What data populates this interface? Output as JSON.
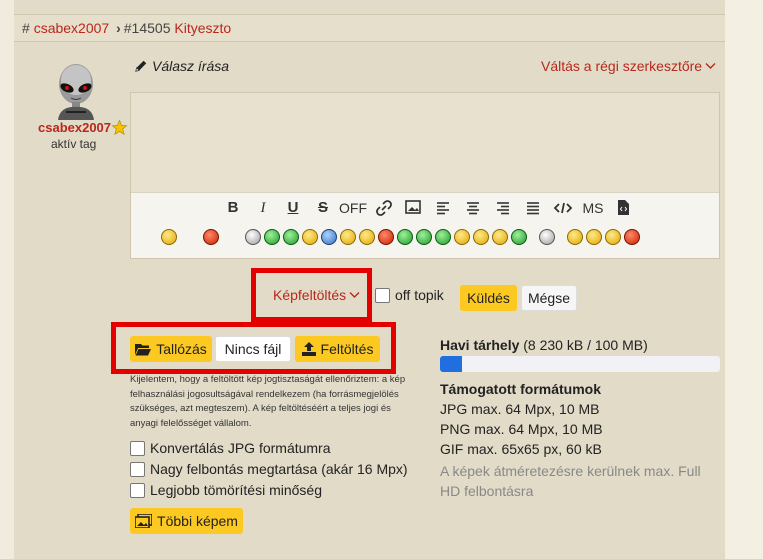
{
  "breadcrumb": {
    "hash": "#",
    "user": "csabex2007",
    "thread_id": "#14505",
    "thread_name": "Kityeszto"
  },
  "author": {
    "name": "csabex2007",
    "role": "aktív tag"
  },
  "editor": {
    "reply_title": "Válasz írása",
    "switch_link": "Váltás a régi szerkesztőre",
    "text_value": "",
    "toolbar": {
      "bold": "B",
      "italic": "I",
      "underline": "U",
      "strike": "S",
      "off": "OFF",
      "ms": "MS"
    }
  },
  "actions": {
    "upload_toggle": "Képfeltöltés",
    "off_topic": "off topik",
    "send": "Küldés",
    "cancel": "Mégse"
  },
  "upload": {
    "browse": "Tallózás",
    "no_file": "Nincs fájl",
    "upload": "Feltöltés",
    "disclaimer": "Kijelentem, hogy a feltöltött kép jogtisztaságát ellenőriztem: a kép felhasználási jogosultságával rendelkezem (ha forrásmegjelölés szükséges, azt megteszem). A kép feltöltéséért a teljes jogi és anyagi felelősséget vállalom.",
    "options": [
      "Konvertálás JPG formátumra",
      "Nagy felbontás megtartása (akár 16 Mpx)",
      "Legjobb tömörítési minőség"
    ],
    "more_images": "Többi képem"
  },
  "quota": {
    "label": "Havi tárhely",
    "value": "(8 230 kB / 100 MB)",
    "fraction": 0.08
  },
  "formats": {
    "title": "Támogatott formátumok",
    "lines": [
      "JPG max. 64 Mpx, 10 MB",
      "PNG max. 64 Mpx, 10 MB",
      "GIF max. 65x65 px, 60 kB"
    ],
    "note": "A képek átméretezésre kerülnek max. Full HD felbontásra"
  },
  "colors": {
    "accent_red": "#b8281c",
    "button_yellow": "#fcc822",
    "progress_blue": "#1f6fe0",
    "highlight_red": "#e40000"
  }
}
